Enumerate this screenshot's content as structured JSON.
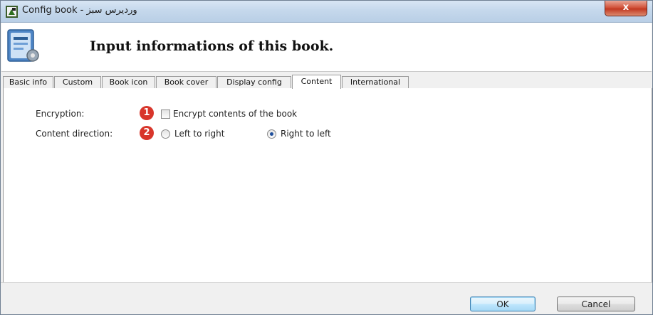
{
  "window": {
    "title": "Config book - ورديرس سبز",
    "close_label": "x"
  },
  "header": {
    "title": "Input informations of this book."
  },
  "tabs": [
    {
      "label": "Basic info",
      "active": false
    },
    {
      "label": "Custom",
      "active": false
    },
    {
      "label": "Book icon",
      "active": false
    },
    {
      "label": "Book cover",
      "active": false
    },
    {
      "label": "Display config",
      "active": false
    },
    {
      "label": "Content",
      "active": true
    },
    {
      "label": "International",
      "active": false
    }
  ],
  "content": {
    "encryption_label": "Encryption:",
    "encryption_badge": "1",
    "encrypt_checkbox_label": "Encrypt contents of the book",
    "encrypt_checked": false,
    "direction_label": "Content direction:",
    "direction_badge": "2",
    "ltr_label": "Left to right",
    "rtl_label": "Right to left",
    "selected_direction": "Right to left"
  },
  "buttons": {
    "ok": "OK",
    "cancel": "Cancel"
  },
  "colors": {
    "badge": "#d8362b",
    "close": "#c23a22"
  }
}
